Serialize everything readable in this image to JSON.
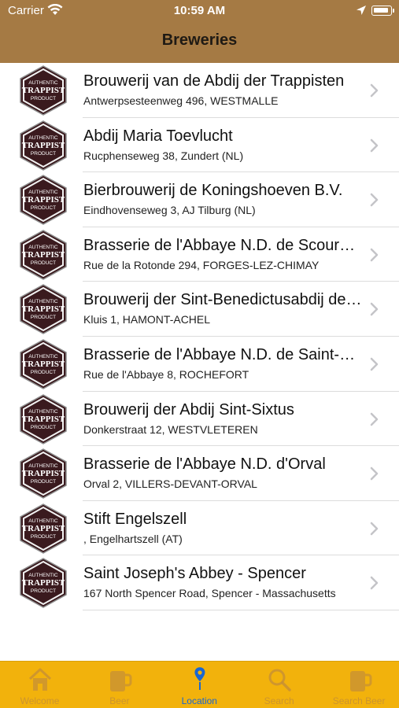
{
  "status_bar": {
    "carrier": "Carrier",
    "time": "10:59 AM"
  },
  "nav": {
    "title": "Breweries"
  },
  "badge": {
    "line1": "AUTHENTIC",
    "line2": "TRAPPIST",
    "line3": "PRODUCT"
  },
  "breweries": [
    {
      "name": "Brouwerij van de Abdij der Trappisten",
      "address": "Antwerpsesteenweg 496, WESTMALLE"
    },
    {
      "name": "Abdij Maria Toevlucht",
      "address": "Rucphenseweg 38, Zundert (NL)"
    },
    {
      "name": "Bierbrouwerij de Koningshoeven B.V.",
      "address": "Eindhovenseweg 3, AJ Tilburg (NL)"
    },
    {
      "name": "Brasserie de l'Abbaye N.D. de Scourmont",
      "address": "Rue de la Rotonde 294, FORGES-LEZ-CHIMAY"
    },
    {
      "name": "Brouwerij der Sint-Benedictusabdij de Achelse Kluis",
      "address": "Kluis 1, HAMONT-ACHEL"
    },
    {
      "name": "Brasserie de l'Abbaye N.D. de Saint-Remy",
      "address": "Rue de l'Abbaye 8, ROCHEFORT"
    },
    {
      "name": "Brouwerij der Abdij Sint-Sixtus",
      "address": "Donkerstraat 12, WESTVLETEREN"
    },
    {
      "name": "Brasserie de l'Abbaye N.D. d'Orval",
      "address": "Orval 2, VILLERS-DEVANT-ORVAL"
    },
    {
      "name": "Stift Engelszell",
      "address": ", Engelhartszell (AT)"
    },
    {
      "name": "Saint Joseph's Abbey - Spencer",
      "address": "167 North Spencer Road, Spencer - Massachusetts"
    }
  ],
  "tabs": [
    {
      "label": "Welcome",
      "icon": "house-icon"
    },
    {
      "label": "Beer",
      "icon": "beer-mug-icon"
    },
    {
      "label": "Location",
      "icon": "location-pin-icon",
      "active": true
    },
    {
      "label": "Search",
      "icon": "magnifier-icon"
    },
    {
      "label": "Search Beer",
      "icon": "beer-mug-search-icon"
    }
  ],
  "colors": {
    "header": "#a57a44",
    "tabbar": "#f2b20c",
    "active_tab": "#1a66d1",
    "badge": "#3a1a1e"
  }
}
